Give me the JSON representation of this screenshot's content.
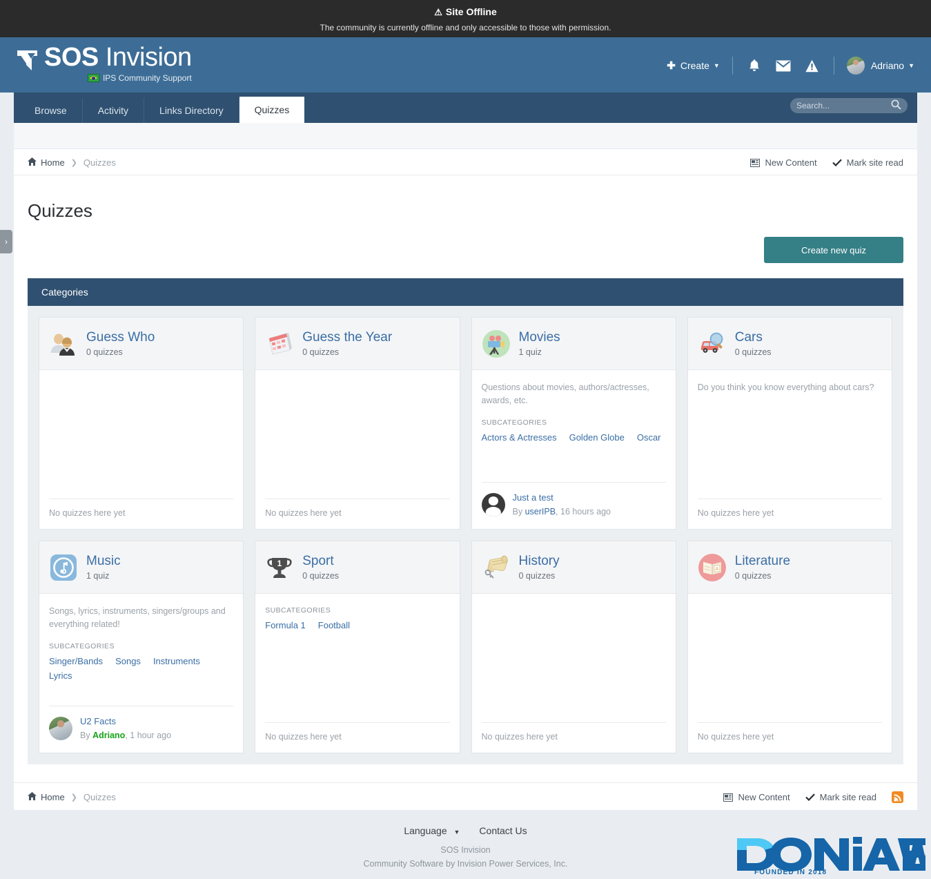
{
  "offline": {
    "icon": "warning-triangle-icon",
    "title": "Site Offline",
    "message": "The community is currently offline and only accessible to those with permission."
  },
  "header": {
    "brand_bold": "SOS",
    "brand_light": "Invision",
    "brand_full": "SOS Invision",
    "tagline": "IPS Community Support",
    "flag_icon": "brazil-flag-icon",
    "create_label": "Create",
    "icons": [
      "notifications-bell-icon",
      "messages-envelope-icon",
      "alerts-warning-icon"
    ],
    "user": "Adriano"
  },
  "nav": {
    "tabs": [
      {
        "label": "Browse",
        "active": false
      },
      {
        "label": "Activity",
        "active": false
      },
      {
        "label": "Links Directory",
        "active": false
      },
      {
        "label": "Quizzes",
        "active": true
      }
    ],
    "search_placeholder": "Search...",
    "search_value": ""
  },
  "breadcrumb": {
    "home": "Home",
    "current": "Quizzes",
    "new_content": "New Content",
    "mark_read": "Mark site read"
  },
  "page": {
    "title": "Quizzes",
    "create_button": "Create new quiz",
    "categories_header": "Categories",
    "subcategories_label": "SUBCATEGORIES",
    "empty_note": "No quizzes here yet",
    "by_label": "By"
  },
  "categories": [
    {
      "name": "Guess Who",
      "icon": "two-people-icon",
      "count": "0 quizzes",
      "description": "",
      "subcategories": [],
      "last_post": null
    },
    {
      "name": "Guess the Year",
      "icon": "calendar-icon",
      "count": "0 quizzes",
      "description": "",
      "subcategories": [],
      "last_post": null
    },
    {
      "name": "Movies",
      "icon": "film-projector-icon",
      "count": "1 quiz",
      "description": "Questions about movies, authors/actresses, awards, etc.",
      "subcategories": [
        "Actors & Actresses",
        "Golden Globe",
        "Oscar"
      ],
      "last_post": {
        "title": "Just a test",
        "author": "userIPB",
        "author_color": "blue",
        "time": "16 hours ago",
        "avatar": "dark"
      }
    },
    {
      "name": "Cars",
      "icon": "car-search-icon",
      "count": "0 quizzes",
      "description": "Do you think you know everything about cars?",
      "subcategories": [],
      "last_post": null
    },
    {
      "name": "Music",
      "icon": "music-note-icon",
      "count": "1 quiz",
      "description": "Songs, lyrics, instruments, singers/groups and everything related!",
      "subcategories": [
        "Singer/Bands",
        "Songs",
        "Instruments",
        "Lyrics"
      ],
      "last_post": {
        "title": "U2 Facts",
        "author": "Adriano",
        "author_color": "green",
        "time": "1 hour ago",
        "avatar": "photo"
      }
    },
    {
      "name": "Sport",
      "icon": "trophy-icon",
      "count": "0 quizzes",
      "description": "",
      "subcategories": [
        "Formula 1",
        "Football"
      ],
      "last_post": null
    },
    {
      "name": "History",
      "icon": "scroll-key-icon",
      "count": "0 quizzes",
      "description": "",
      "subcategories": [],
      "last_post": null
    },
    {
      "name": "Literature",
      "icon": "open-book-icon",
      "count": "0 quizzes",
      "description": "",
      "subcategories": [],
      "last_post": null
    }
  ],
  "footer": {
    "language": "Language",
    "contact": "Contact Us",
    "site_name": "SOS Invision",
    "credit": "Community Software by Invision Power Services, Inc.",
    "logo_text": "DONiAWEB",
    "logo_sub": "FOUNDED IN 2018"
  },
  "colors": {
    "header_blue": "#3d6d96",
    "nav_blue": "#2f5070",
    "accent_teal": "#357f86",
    "link_blue": "#3a6ea5",
    "offline_bg": "#2b2b2b",
    "page_bg": "#e9edf1",
    "username_green": "#16a316",
    "rss_orange": "#f28a21"
  },
  "side_handle": "›"
}
